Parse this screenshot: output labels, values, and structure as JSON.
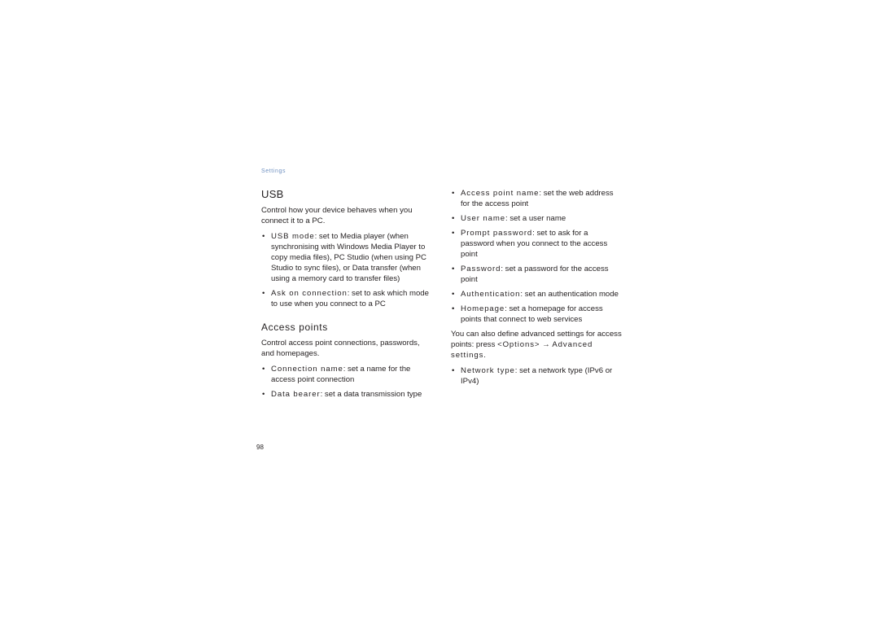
{
  "running_head": "Settings",
  "page_number": "98",
  "left_column": {
    "usb": {
      "title": "USB",
      "intro": "Control how your device behaves when you connect it to a PC.",
      "items": [
        {
          "term": "USB mode",
          "text": ": set to Media player (when synchronising with Windows Media Player to copy media files), PC Studio (when using PC Studio to sync files), or Data transfer (when using a memory card to transfer files)"
        },
        {
          "term": "Ask on connection",
          "text": ": set to ask which mode to use when you connect to a PC"
        }
      ]
    },
    "access_points": {
      "title": "Access points",
      "intro": "Control access point connections, passwords, and homepages.",
      "items": [
        {
          "term": "Connection name",
          "text": ": set a name for the access point connection"
        },
        {
          "term": "Data bearer",
          "text": ": set a data transmission type"
        }
      ]
    }
  },
  "right_column": {
    "items": [
      {
        "term": "Access point name",
        "text": ": set the web address for the access point"
      },
      {
        "term": "User name",
        "text": ": set a user name"
      },
      {
        "term": "Prompt password",
        "text": ": set to ask for a password when you connect to the access point"
      },
      {
        "term": "Password",
        "text": ": set a password for the access point"
      },
      {
        "term": "Authentication",
        "text": ": set an authentication mode"
      },
      {
        "term": "Homepage",
        "text": ": set a homepage for access points that connect to web services"
      }
    ],
    "advanced_note": {
      "prefix": "You can also define advanced settings for access points: press ",
      "key": "<Options>",
      "arrow": " → ",
      "path": "Advanced settings",
      "suffix": "."
    },
    "advanced_items": [
      {
        "term": "Network type",
        "text": ": set a network type (IPv6 or IPv4)"
      }
    ]
  },
  "colors": {
    "running_head": "#6d8fc0",
    "text": "#231f20"
  }
}
